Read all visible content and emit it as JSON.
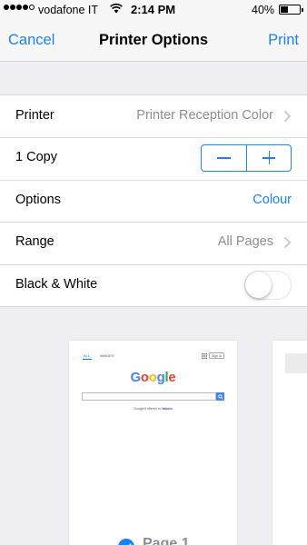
{
  "status_bar": {
    "signal_bars": 4,
    "signal_max": 5,
    "carrier": "vodafone IT",
    "time": "2:14 PM",
    "battery_percent": "40%",
    "battery_level": 0.4
  },
  "nav": {
    "cancel_label": "Cancel",
    "title": "Printer Options",
    "print_label": "Print"
  },
  "settings": {
    "printer": {
      "label": "Printer",
      "value": "Printer Reception Color"
    },
    "copies": {
      "label": "1 Copy"
    },
    "options": {
      "label": "Options",
      "value": "Colour"
    },
    "range": {
      "label": "Range",
      "value": "All Pages"
    },
    "black_white": {
      "label": "Black & White",
      "enabled": false
    }
  },
  "preview": {
    "page1": {
      "tab_all": "ALL",
      "tab_images": "IMAGES",
      "sign_in": "Sign in",
      "logo_letters": [
        {
          "char": "G",
          "color": "#4285f4"
        },
        {
          "char": "o",
          "color": "#ea4335"
        },
        {
          "char": "o",
          "color": "#fbbc05"
        },
        {
          "char": "g",
          "color": "#4285f4"
        },
        {
          "char": "l",
          "color": "#34a853"
        },
        {
          "char": "e",
          "color": "#ea4335"
        }
      ],
      "offered_text": "Google.it offered in:",
      "offered_lang": "Italiano",
      "selected": true,
      "label": "Page 1"
    }
  },
  "colors": {
    "accent": "#1a82fb",
    "secondary_text": "#8e8e93",
    "grouped_background": "#efeff4"
  }
}
